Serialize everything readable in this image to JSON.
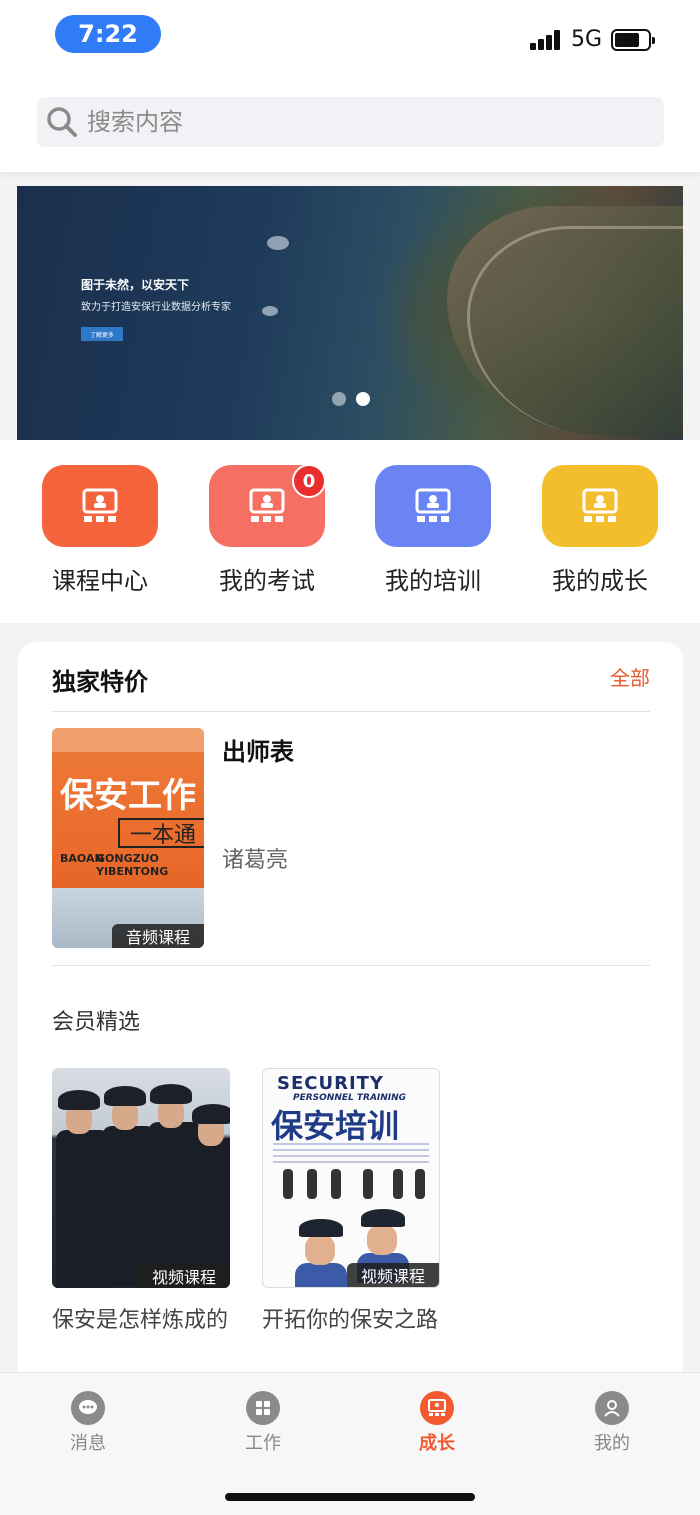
{
  "status_bar": {
    "time": "7:22",
    "network": "5G"
  },
  "search": {
    "placeholder": "搜索内容"
  },
  "banner": {
    "headline": "图于未然，以安天下",
    "subtitle": "致力于打造安保行业数据分析专家",
    "button_label": "了解更多",
    "active_slide": 2,
    "slide_count": 2
  },
  "quick_menu": {
    "items": [
      {
        "label": "课程中心",
        "color": "#f5643c",
        "icon": "presentation-icon"
      },
      {
        "label": "我的考试",
        "color": "#f56f63",
        "icon": "presentation-icon",
        "badge": "0"
      },
      {
        "label": "我的培训",
        "color": "#6a84f4",
        "icon": "presentation-icon"
      },
      {
        "label": "我的成长",
        "color": "#f2be2e",
        "icon": "presentation-icon"
      }
    ]
  },
  "exclusive": {
    "title": "独家特价",
    "more_label": "全部",
    "course": {
      "name": "出师表",
      "author": "诸葛亮",
      "tag": "音频课程",
      "cover": {
        "title": "保安工作",
        "box": "一本通",
        "pinyin_a": "BAOAN",
        "pinyin_b": "GONGZUO",
        "pinyin_c": "YIBENTONG"
      }
    }
  },
  "member": {
    "title": "会员精选",
    "items": [
      {
        "title": "保安是怎样炼成的",
        "tag": "视频课程"
      },
      {
        "title": "开拓你的保安之路",
        "tag": "视频课程",
        "cover": {
          "security": "SECURITY",
          "personnel": "PERSONNEL TRAINING",
          "big": "保安培训"
        }
      }
    ]
  },
  "tabbar": {
    "items": [
      {
        "label": "消息",
        "icon": "chat-bubble-icon",
        "active": false
      },
      {
        "label": "工作",
        "icon": "grid-icon",
        "active": false
      },
      {
        "label": "成长",
        "icon": "presentation-icon",
        "active": true
      },
      {
        "label": "我的",
        "icon": "person-icon",
        "active": false
      }
    ]
  },
  "colors": {
    "accent": "#f25a30",
    "status_pill": "#2f7cf6"
  }
}
